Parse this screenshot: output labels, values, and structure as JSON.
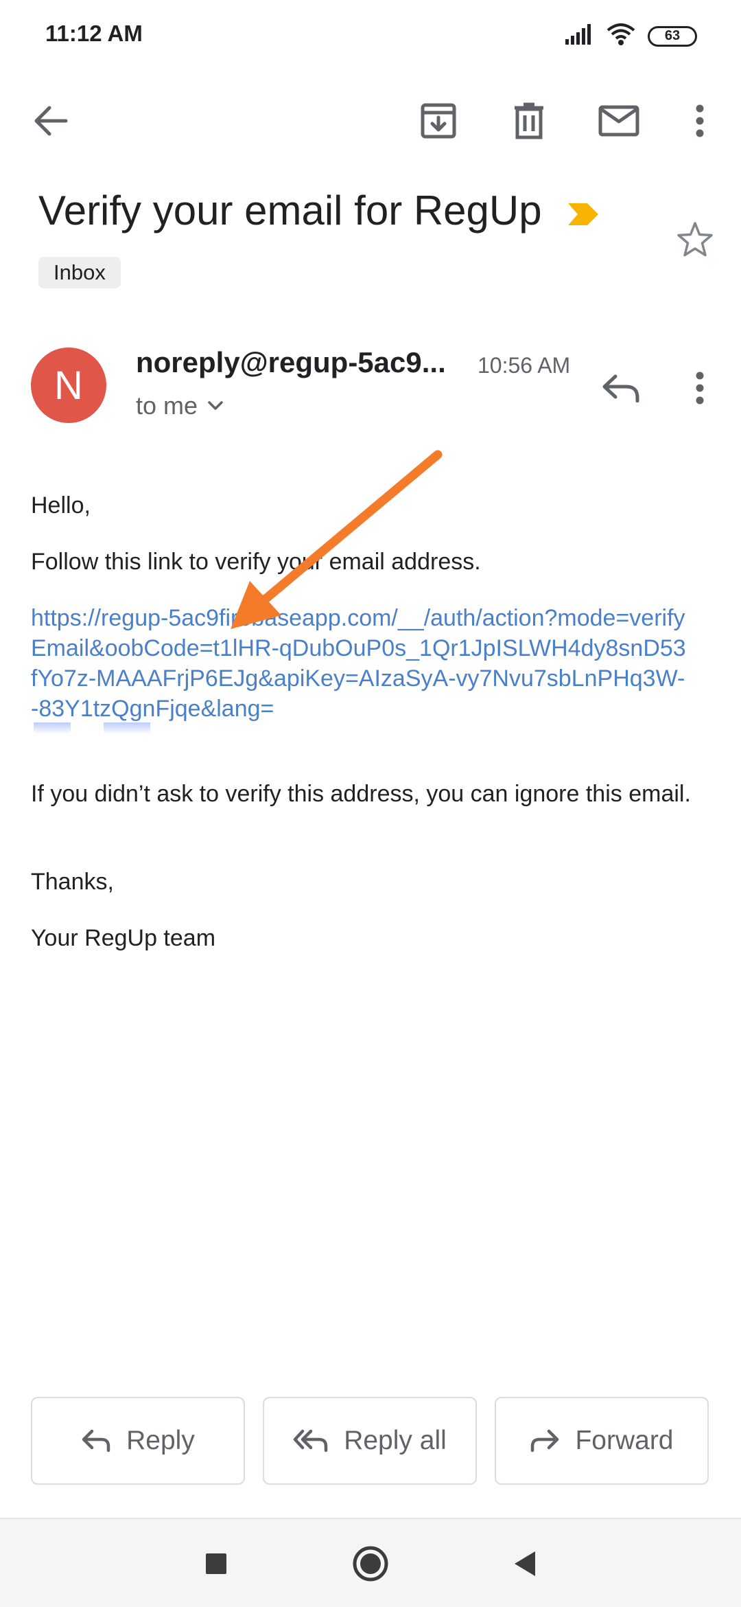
{
  "status_bar": {
    "time": "11:12 AM",
    "battery_level": "63",
    "icons": [
      "signal-icon",
      "wifi-icon",
      "battery-icon"
    ]
  },
  "toolbar": {
    "icons": [
      "back-arrow-icon",
      "archive-icon",
      "trash-icon",
      "mail-icon",
      "more-vert-icon"
    ]
  },
  "email": {
    "subject": "Verify your email for RegUp",
    "label": "Inbox",
    "sender": {
      "initial": "N",
      "name": "noreply@regup-5ac9...",
      "time": "10:56 AM",
      "recipient": "to me"
    },
    "body": {
      "greeting": "Hello,",
      "instructions": "Follow this link to verify your email address.",
      "link": "https://regup-5ac9firebaseapp.com/__/auth/action?mode=verifyEmail&oobCode=t1lHR-qDubOuP0s_1Qr1JpISLWH4dy8snD53fYo7z-MAAAFrjP6EJg&apiKey=AIzaSyA-vy7Nvu7sbLnPHq3W--83Y1tzQgnFjqe&lang=",
      "warning": "If you didn’t ask to verify this address, you can ignore this email.",
      "thanks": "Thanks,",
      "signature": "Your RegUp team"
    }
  },
  "actions": {
    "reply": "Reply",
    "reply_all": "Reply all",
    "forward": "Forward"
  },
  "colors": {
    "avatar": "#e0574a",
    "link": "#4a7fc9",
    "annotation_arrow": "#f47b2a",
    "importance_marker": "#f6b400"
  }
}
